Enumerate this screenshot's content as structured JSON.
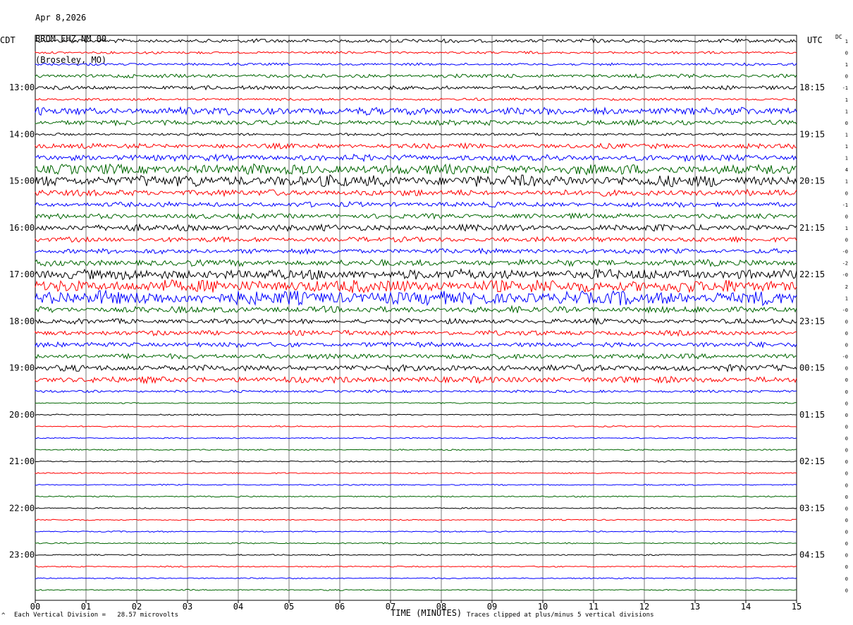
{
  "header": {
    "date": "Apr 8,2026",
    "station": "BROM EHZ NM 00",
    "location": "(Broseley, MO)"
  },
  "left_zone": "CDT",
  "right_zone": "UTC",
  "dc_label": "DC",
  "footer": {
    "scale_text": "Each Vertical Division =   28.57 microvolts",
    "xlabel": "TIME (MINUTES)",
    "clip_text": "Traces clipped at plus/minus 5 vertical divisions",
    "corner_mark": "^"
  },
  "colors": [
    "#000000",
    "#ff0000",
    "#0000ff",
    "#006600"
  ],
  "chart_data": {
    "type": "line",
    "xlabel": "TIME (MINUTES)",
    "x_ticks": [
      "00",
      "01",
      "02",
      "03",
      "04",
      "05",
      "06",
      "07",
      "08",
      "09",
      "10",
      "11",
      "12",
      "13",
      "14",
      "15"
    ],
    "xlim": [
      0,
      15
    ],
    "left_time_labels": [
      "13:00",
      "14:00",
      "15:00",
      "16:00",
      "17:00",
      "18:00",
      "19:00",
      "20:00",
      "21:00",
      "22:00",
      "23:00"
    ],
    "right_time_labels": [
      "18:15",
      "19:15",
      "20:15",
      "21:15",
      "22:15",
      "23:15",
      "00:15",
      "01:15",
      "02:15",
      "03:15",
      "04:15"
    ],
    "dc_offsets": [
      "1",
      "0",
      "1",
      "0",
      "-1",
      "1",
      "1",
      "0",
      "1",
      "1",
      "1",
      "4",
      "1",
      "0",
      "-1",
      "0",
      "1",
      "0",
      "-0",
      "-2",
      "-0",
      "2",
      "1",
      "-0",
      "0",
      "0",
      "0",
      "-0",
      "0",
      "0",
      "0",
      "0",
      "0",
      "0",
      "0",
      "0",
      "0",
      "0",
      "0",
      "0",
      "0",
      "0",
      "0",
      "0",
      "0",
      "0",
      "0",
      "0"
    ],
    "trace_amplitude": [
      3,
      2,
      2,
      3,
      3,
      2,
      6,
      4,
      2,
      4,
      5,
      8,
      9,
      5,
      4,
      4,
      5,
      4,
      4,
      5,
      8,
      10,
      11,
      5,
      4,
      4,
      4,
      4,
      5,
      5,
      2,
      1,
      1,
      1,
      1,
      1,
      1,
      1,
      1,
      1,
      1,
      1,
      1,
      1,
      1,
      1,
      1,
      1
    ]
  }
}
